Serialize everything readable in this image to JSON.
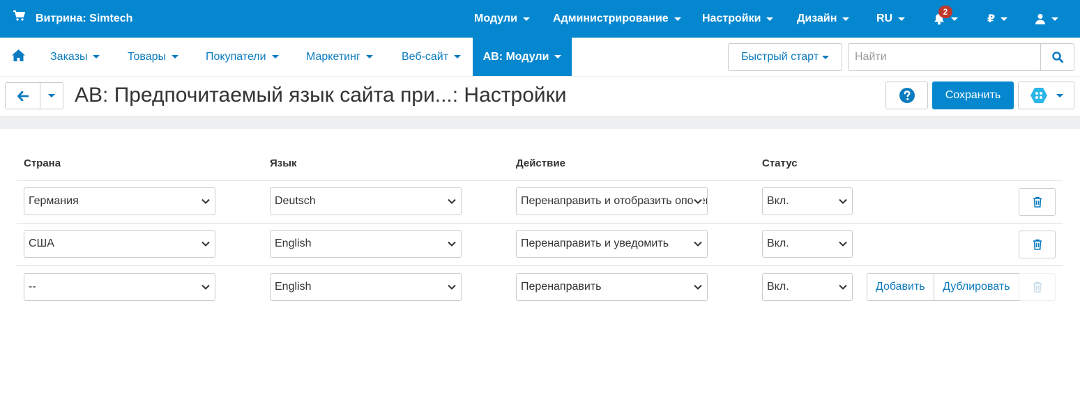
{
  "topbar": {
    "store_label": "Витрина: Simtech",
    "menus": [
      "Модули",
      "Администрирование",
      "Настройки",
      "Дизайн",
      "RU"
    ],
    "notification_count": "2",
    "currency": "₽",
    "bg_color": "#0587cf"
  },
  "nav": {
    "items": [
      "Заказы",
      "Товары",
      "Покупатели",
      "Маркетинг",
      "Веб-сайт",
      "AB: Модули"
    ],
    "active_index": 5,
    "quick_start_label": "Быстрый старт",
    "search_placeholder": "Найти"
  },
  "titlebar": {
    "title": "AB: Предпочитаемый язык сайта при...: Настройки",
    "save_label": "Сохранить"
  },
  "table": {
    "headers": {
      "country": "Страна",
      "language": "Язык",
      "action": "Действие",
      "status": "Статус"
    },
    "rows": [
      {
        "country": "Германия",
        "language": "Deutsch",
        "action": "Перенаправить и отобразить оповещение",
        "status": "Вкл."
      },
      {
        "country": "США",
        "language": "English",
        "action": "Перенаправить и уведомить",
        "status": "Вкл."
      },
      {
        "country": "--",
        "language": "English",
        "action": "Перенаправить",
        "status": "Вкл."
      }
    ],
    "add_label": "Добавить",
    "duplicate_label": "Дублировать"
  },
  "icons": {
    "cart": "cart-icon",
    "bell": "bell-icon",
    "user": "user-icon",
    "home": "home-icon",
    "search": "search-icon",
    "back": "arrow-left-icon",
    "help": "question-circle-icon",
    "addons": "hexagon-icon",
    "delete": "trash-icon",
    "dropdown": "chevron-down-icon"
  }
}
